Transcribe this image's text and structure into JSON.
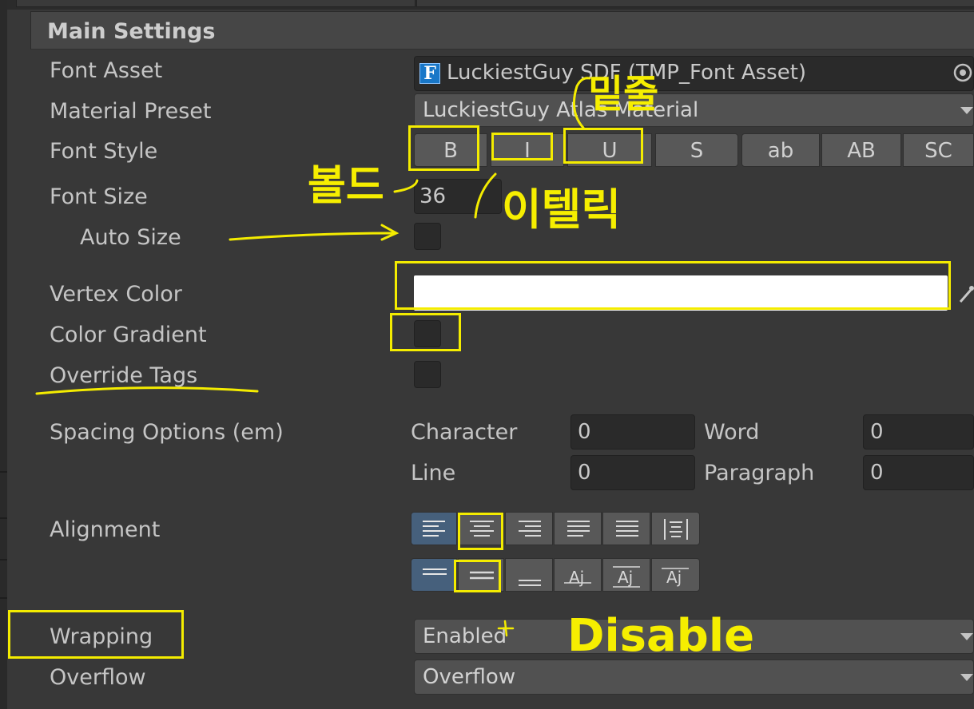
{
  "section": {
    "title": "Main Settings"
  },
  "font_asset": {
    "label": "Font Asset",
    "value": "LuckiestGuy SDF (TMP_Font Asset)",
    "icon": "font-asset-icon"
  },
  "material_preset": {
    "label": "Material Preset",
    "value": "LuckiestGuy Atlas Material"
  },
  "font_style": {
    "label": "Font Style",
    "buttons": [
      "B",
      "I",
      "U",
      "S",
      "ab",
      "AB",
      "SC"
    ]
  },
  "font_size": {
    "label": "Font Size",
    "value": "36"
  },
  "auto_size": {
    "label": "Auto Size"
  },
  "vertex_color": {
    "label": "Vertex Color",
    "color": "#ffffff"
  },
  "color_gradient": {
    "label": "Color Gradient"
  },
  "override_tags": {
    "label": "Override Tags"
  },
  "spacing": {
    "label": "Spacing Options (em)",
    "character_label": "Character",
    "character_value": "0",
    "word_label": "Word",
    "word_value": "0",
    "line_label": "Line",
    "line_value": "0",
    "paragraph_label": "Paragraph",
    "paragraph_value": "0"
  },
  "alignment": {
    "label": "Alignment",
    "horizontal": [
      "align-left-icon",
      "align-center-icon",
      "align-right-icon",
      "align-justify-icon",
      "align-flush-icon",
      "align-geometry-center-icon"
    ],
    "vertical": [
      "align-top-icon",
      "align-middle-icon",
      "align-bottom-icon",
      "align-baseline-icon",
      "align-midline-icon",
      "align-capline-icon"
    ]
  },
  "wrapping": {
    "label": "Wrapping",
    "value": "Enabled"
  },
  "overflow": {
    "label": "Overflow",
    "value": "Overflow"
  },
  "annotations": {
    "bold": "볼드",
    "italic": "이텔릭",
    "underline": "밑줄",
    "disable": "Disable"
  },
  "colors": {
    "highlight": "#f4ec00",
    "selected": "#46607c",
    "panel": "#383838"
  }
}
